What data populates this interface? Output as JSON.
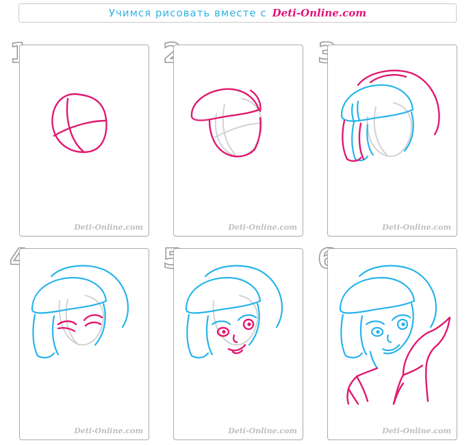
{
  "banner": {
    "text": "Учимся рисовать вместе с",
    "brand": "Deti-Online.com"
  },
  "steps": [
    {
      "number": "1",
      "watermark": "Deti-Online.com"
    },
    {
      "number": "2",
      "watermark": "Deti-Online.com"
    },
    {
      "number": "3",
      "watermark": "Deti-Online.com"
    },
    {
      "number": "4",
      "watermark": "Deti-Online.com"
    },
    {
      "number": "5",
      "watermark": "Deti-Online.com"
    },
    {
      "number": "6",
      "watermark": "Deti-Online.com"
    }
  ],
  "colors": {
    "new_line": "#e0186f",
    "done_line": "#27b3ea",
    "guide_line": "#d2d2d2",
    "accent": "#32b3e3"
  }
}
